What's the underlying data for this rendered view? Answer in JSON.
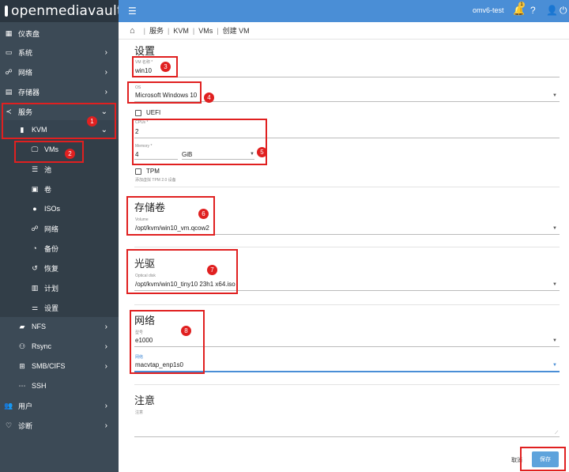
{
  "app": {
    "title": "openmediavault",
    "hostname": "omv6-test",
    "notification_count": "1"
  },
  "sidebar": {
    "items": [
      {
        "label": "仪表盘",
        "icon": "dashboard-icon"
      },
      {
        "label": "系统",
        "icon": "laptop-icon"
      },
      {
        "label": "网络",
        "icon": "network-icon"
      },
      {
        "label": "存储器",
        "icon": "storage-icon"
      },
      {
        "label": "服务",
        "icon": "share-icon"
      },
      {
        "label": "KVM",
        "icon": "server-icon"
      },
      {
        "label": "VMs",
        "icon": "monitor-icon"
      },
      {
        "label": "池",
        "icon": "pool-icon"
      },
      {
        "label": "卷",
        "icon": "volume-icon"
      },
      {
        "label": "ISOs",
        "icon": "disc-icon"
      },
      {
        "label": "网络",
        "icon": "network-icon"
      },
      {
        "label": "备份",
        "icon": "backup-icon"
      },
      {
        "label": "恢复",
        "icon": "restore-icon"
      },
      {
        "label": "计划",
        "icon": "calendar-icon"
      },
      {
        "label": "设置",
        "icon": "sliders-icon"
      },
      {
        "label": "NFS",
        "icon": "folder-icon"
      },
      {
        "label": "Rsync",
        "icon": "rsync-icon"
      },
      {
        "label": "SMB/CIFS",
        "icon": "smb-icon"
      },
      {
        "label": "SSH",
        "icon": "ssh-icon"
      },
      {
        "label": "用户",
        "icon": "users-icon"
      },
      {
        "label": "诊断",
        "icon": "heartbeat-icon"
      }
    ]
  },
  "breadcrumb": [
    "服务",
    "KVM",
    "VMs",
    "创建 VM"
  ],
  "form": {
    "settings_title": "设置",
    "vm_name_label": "VM 名称 *",
    "vm_name_value": "win10",
    "os_label": "OS",
    "os_value": "Microsoft Windows 10",
    "uefi_label": "UEFI",
    "cpus_label": "CPUs *",
    "cpus_value": "2",
    "memory_label": "Memory *",
    "memory_value": "4",
    "memory_unit": "GiB",
    "tpm_label": "TPM",
    "tpm_hint": "添加虚拟 TPM 2.0 设备",
    "storage_title": "存储卷",
    "volume_label": "Volume",
    "volume_value": "/opt/kvm/win10_vm.qcow2",
    "optical_title": "光驱",
    "optical_label": "Optical disk",
    "optical_value": "/opt/kvm/win10_tiny10 23h1 x64.iso",
    "network_title": "网络",
    "model_label": "型号",
    "model_value": "e1000",
    "net_label": "网络",
    "net_value": "macvtap_enp1s0",
    "notes_title": "注意",
    "notes_label": "注意",
    "cancel": "取消",
    "save": "保存"
  },
  "annotations": [
    "1",
    "2",
    "3",
    "4",
    "5",
    "6",
    "7",
    "8"
  ],
  "colors": {
    "sidebar": "#3c4a56",
    "topbar": "#4a8ed6",
    "highlight": "#e02020",
    "save": "#5ea3dc"
  }
}
